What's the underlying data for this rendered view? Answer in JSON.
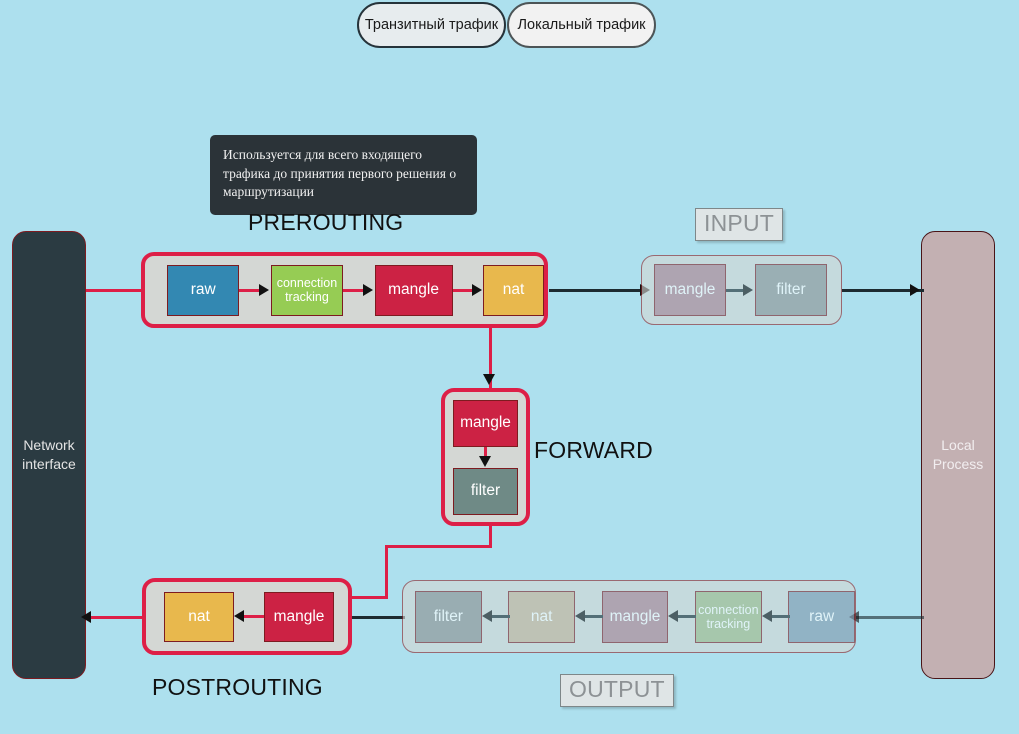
{
  "top_buttons": [
    {
      "label": "Транзитный трафик",
      "state": "selected"
    },
    {
      "label": "Локальный трафик",
      "state": "normal"
    }
  ],
  "tooltip": {
    "text": "Используется для всего входящего трафика до принятия первого решения о маршрутизации"
  },
  "endpoints": {
    "network_interface": {
      "label": "Network\ninterface",
      "color": "#2b3b42"
    },
    "local_process": {
      "label": "Local\nProcess",
      "color": "#c3b0b2"
    }
  },
  "chains": {
    "prerouting": {
      "label": "PREROUTING",
      "active": true,
      "boxes": [
        {
          "label": "raw",
          "color": "#3388b2"
        },
        {
          "label": "connection\ntracking",
          "color": "#96cc54"
        },
        {
          "label": "mangle",
          "color": "#cc2244"
        },
        {
          "label": "nat",
          "color": "#e8b84d"
        }
      ]
    },
    "input": {
      "label": "INPUT",
      "active": false,
      "boxes": [
        {
          "label": "mangle",
          "color": "#b0808c"
        },
        {
          "label": "filter",
          "color": "#909292"
        }
      ]
    },
    "forward": {
      "label": "FORWARD",
      "active": true,
      "boxes": [
        {
          "label": "mangle",
          "color": "#cc2244"
        },
        {
          "label": "filter",
          "color": "#6f8a86"
        }
      ]
    },
    "postrouting": {
      "label": "POSTROUTING",
      "active": true,
      "boxes": [
        {
          "label": "nat",
          "color": "#e8b84d"
        },
        {
          "label": "mangle",
          "color": "#cc2244"
        }
      ]
    },
    "output": {
      "label": "OUTPUT",
      "active": false,
      "boxes": [
        {
          "label": "filter",
          "color": "#8d8f8f"
        },
        {
          "label": "nat",
          "color": "#c9b193"
        },
        {
          "label": "mangle",
          "color": "#b0808c"
        },
        {
          "label": "connection\ntracking",
          "color": "#a3b985"
        },
        {
          "label": "raw",
          "color": "#8098ad"
        }
      ]
    }
  },
  "colors": {
    "background": "#ade0ee",
    "accent_active": "#dd1f47",
    "accent_dim": "#8f2126",
    "chain_fill": "#d4d7d4",
    "line_dark": "#1d2b30"
  }
}
